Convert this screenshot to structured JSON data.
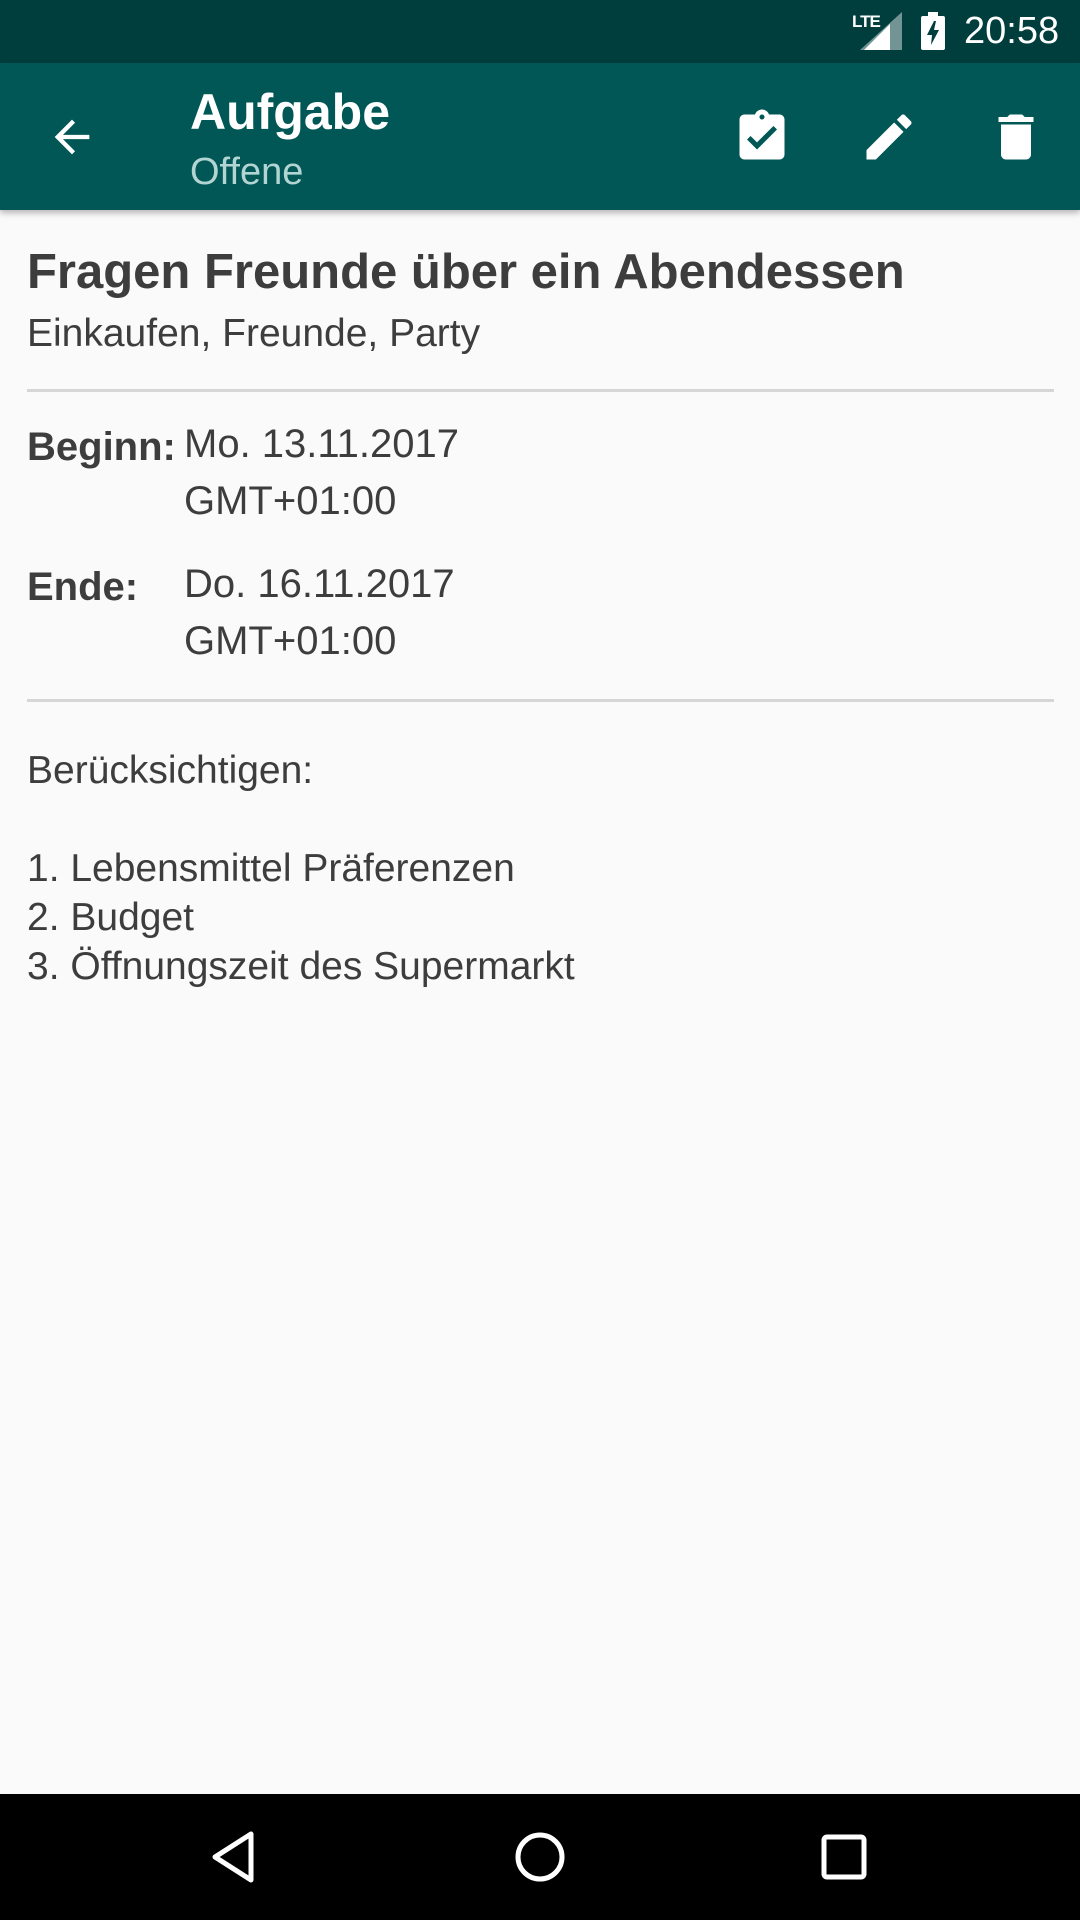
{
  "status_bar": {
    "network": "LTE",
    "time": "20:58"
  },
  "app_bar": {
    "title": "Aufgabe",
    "subtitle": "Offene",
    "back_icon": "arrow-back-icon",
    "actions": [
      {
        "name": "complete-task-button",
        "icon": "clipboard-check-icon"
      },
      {
        "name": "edit-task-button",
        "icon": "pencil-icon"
      },
      {
        "name": "delete-task-button",
        "icon": "trash-icon"
      }
    ]
  },
  "task": {
    "title": "Fragen Freunde über ein Abendessen",
    "tags": "Einkaufen, Freunde, Party",
    "begin": {
      "label": "Beginn:",
      "date": "Mo. 13.11.2017",
      "timezone": "GMT+01:00"
    },
    "end": {
      "label": "Ende:",
      "date": "Do. 16.11.2017",
      "timezone": "GMT+01:00"
    },
    "description": "Berücksichtigen:\n\n1. Lebensmittel Präferenzen\n2. Budget\n3. Öffnungszeit des Supermarkt"
  },
  "colors": {
    "status_bar": "#003d3d",
    "app_bar": "#005755",
    "subtitle": "#b2d4d2",
    "text": "#3d3d3d",
    "divider": "#d6d6d6",
    "background": "#fafafa",
    "nav_bar": "#000000"
  }
}
